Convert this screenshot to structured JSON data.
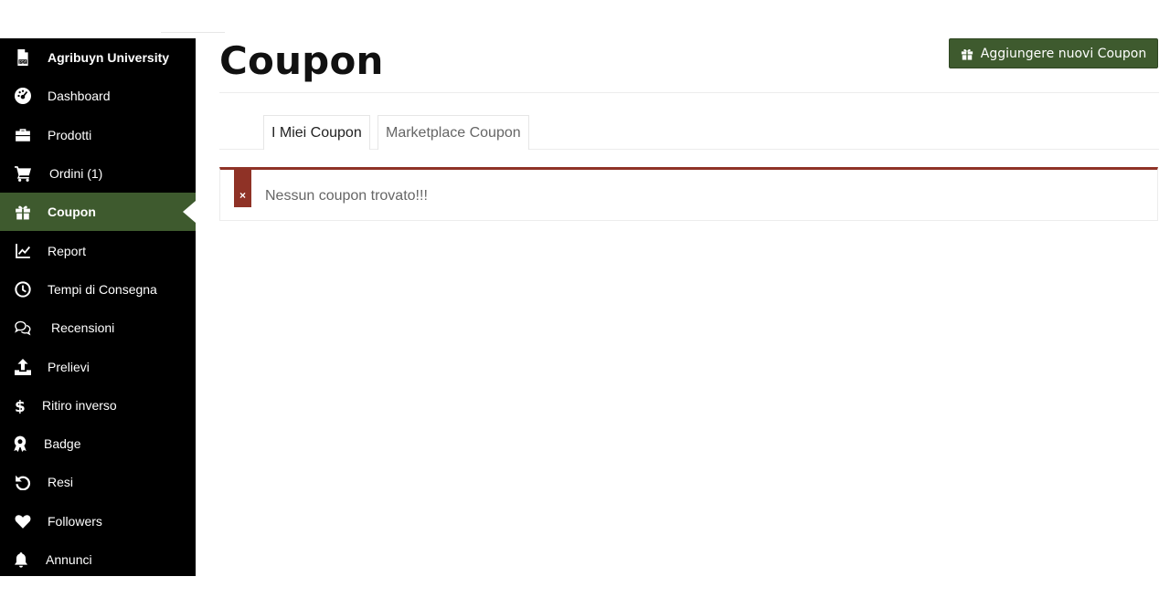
{
  "sidebar": {
    "items": [
      {
        "label": "Agribuyn University",
        "icon": "pdf-file-icon"
      },
      {
        "label": "Dashboard",
        "icon": "dashboard-icon"
      },
      {
        "label": "Prodotti",
        "icon": "briefcase-icon"
      },
      {
        "label": "Ordini (1)",
        "icon": "cart-icon"
      },
      {
        "label": "Coupon",
        "icon": "gift-icon"
      },
      {
        "label": "Report",
        "icon": "line-chart-icon"
      },
      {
        "label": "Tempi di Consegna",
        "icon": "clock-icon"
      },
      {
        "label": "Recensioni",
        "icon": "comments-icon"
      },
      {
        "label": "Prelievi",
        "icon": "upload-icon"
      },
      {
        "label": "Ritiro inverso",
        "icon": "dollar-icon"
      },
      {
        "label": "Badge",
        "icon": "award-icon"
      },
      {
        "label": "Resi",
        "icon": "undo-icon"
      },
      {
        "label": "Followers",
        "icon": "heart-icon"
      },
      {
        "label": "Annunci",
        "icon": "bell-icon"
      }
    ],
    "active": "Coupon"
  },
  "header": {
    "title": "Coupon",
    "add_button_label": "Aggiungere nuovi Coupon"
  },
  "tabs": [
    {
      "label": "I Miei Coupon",
      "active": true
    },
    {
      "label": "Marketplace Coupon",
      "active": false
    }
  ],
  "notice": {
    "icon_glyph": "×",
    "message": "Nessun coupon trovato!!!"
  },
  "colors": {
    "sidebar_bg": "#000000",
    "accent_green": "#3e5a2e",
    "error_red": "#8f3226"
  }
}
